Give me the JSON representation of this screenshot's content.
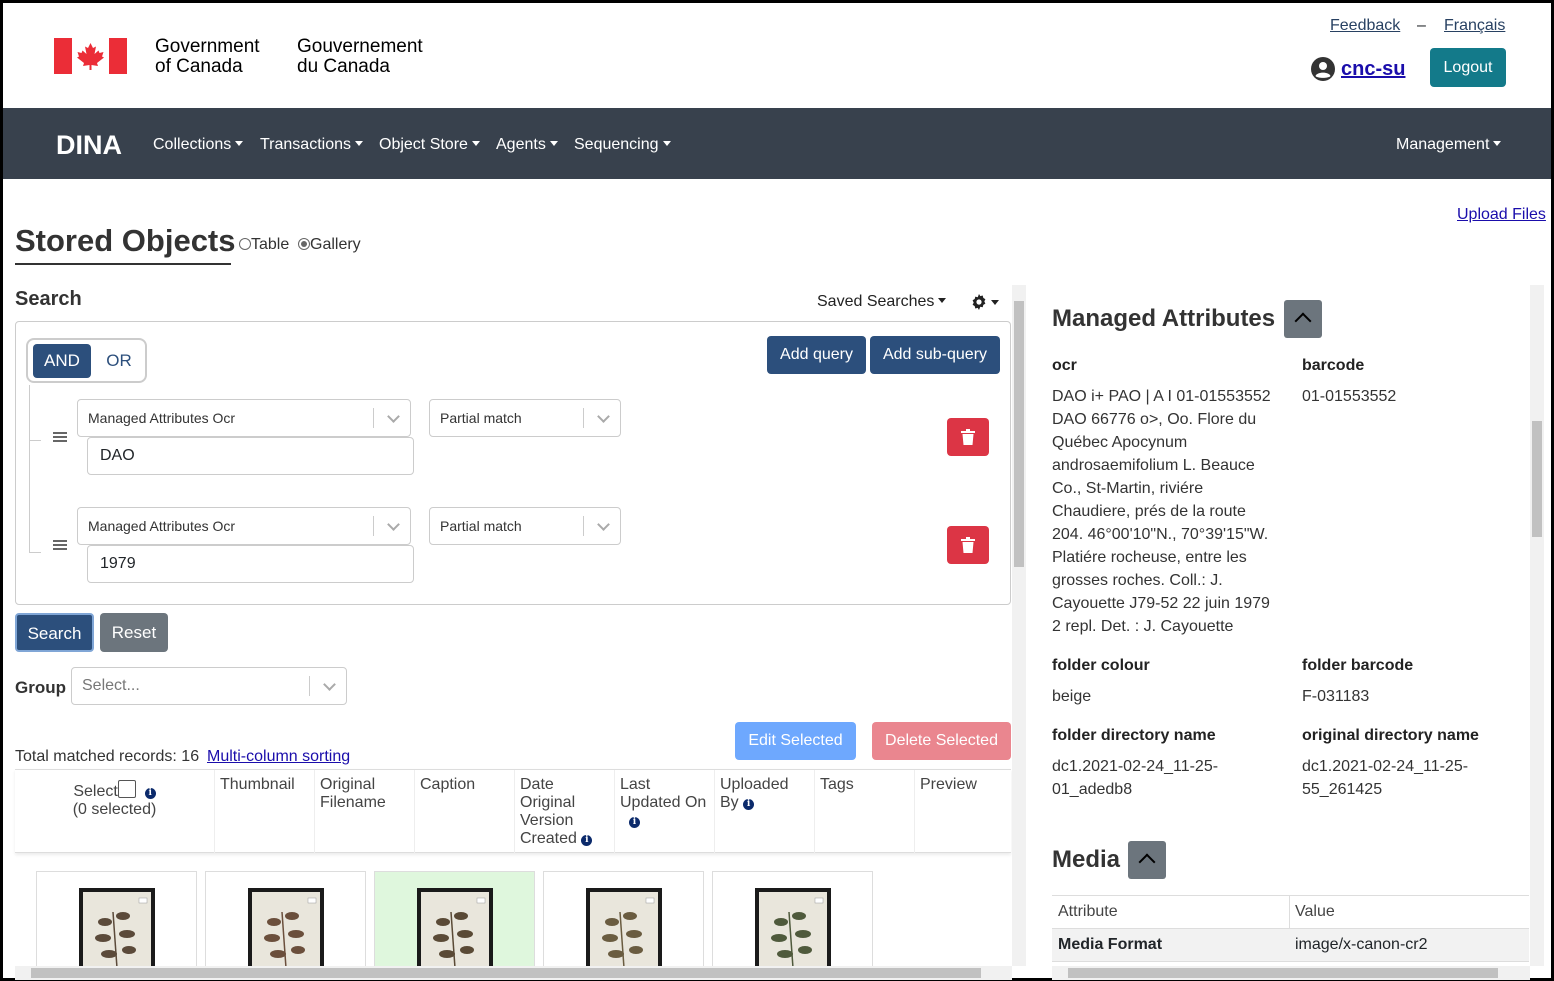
{
  "header": {
    "gov_en_line1": "Government",
    "gov_en_line2": "of Canada",
    "gov_fr_line1": "Gouvernement",
    "gov_fr_line2": "du Canada",
    "feedback": "Feedback",
    "separator": "–",
    "language": "Français",
    "username": "cnc-su",
    "logout": "Logout"
  },
  "nav": {
    "brand": "DINA",
    "items": [
      "Collections",
      "Transactions",
      "Object Store",
      "Agents",
      "Sequencing"
    ],
    "management": "Management"
  },
  "page": {
    "title": "Stored Objects",
    "view_table": "Table",
    "view_gallery": "Gallery",
    "view_selected": "Gallery",
    "upload_files": "Upload Files"
  },
  "search": {
    "heading": "Search",
    "saved_searches": "Saved Searches",
    "and": "AND",
    "or": "OR",
    "add_query": "Add query",
    "add_sub_query": "Add sub-query",
    "rows": [
      {
        "field": "Managed Attributes Ocr",
        "match": "Partial match",
        "value": "DAO"
      },
      {
        "field": "Managed Attributes Ocr",
        "match": "Partial match",
        "value": "1979"
      }
    ],
    "search_button": "Search",
    "reset_button": "Reset",
    "group_label": "Group",
    "group_placeholder": "Select..."
  },
  "results": {
    "edit_selected": "Edit Selected",
    "delete_selected": "Delete Selected",
    "total_label": "Total matched records: 16",
    "multi_sort": "Multi-column sorting",
    "columns": {
      "select": "Select",
      "selected_count": "(0 selected)",
      "thumbnail": "Thumbnail",
      "original_filename_1": "Original",
      "original_filename_2": "Filename",
      "caption": "Caption",
      "date_1": "Date",
      "date_2": "Original",
      "date_3": "Version",
      "date_4": "Created",
      "last_updated_1": "Last",
      "last_updated_2": "Updated On",
      "uploaded_by_1": "Uploaded",
      "uploaded_by_2": "By",
      "tags": "Tags",
      "preview": "Preview"
    },
    "cards_count": 5,
    "selected_card_index": 2
  },
  "managed_attributes": {
    "heading": "Managed Attributes",
    "items": [
      {
        "key": "ocr",
        "value": [
          "DAO i+ PAO | A I 01-01553552",
          "DAO 66776 o>, Oo. Flore du",
          "Québec Apocynum",
          "androsaemifolium L. Beauce",
          "Co., St-Martin, riviére",
          "Chaudiere, prés de la route",
          "204. 46°00'10\"N., 70°39'15\"W.",
          "Platiére rocheuse, entre les",
          "grosses roches. Coll.: J.",
          "Cayouette J79-52 22 juin 1979",
          "2 repl. Det. : J. Cayouette"
        ]
      },
      {
        "key": "barcode",
        "value": [
          "01-01553552"
        ]
      },
      {
        "key": "folder colour",
        "value": [
          "beige"
        ]
      },
      {
        "key": "folder barcode",
        "value": [
          "F-031183"
        ]
      },
      {
        "key": "folder directory name",
        "value": [
          "dc1.2021-02-24_11-25-",
          "01_adedb8"
        ]
      },
      {
        "key": "original directory name",
        "value": [
          "dc1.2021-02-24_11-25-",
          "55_261425"
        ]
      }
    ]
  },
  "media": {
    "heading": "Media",
    "col_attribute": "Attribute",
    "col_value": "Value",
    "rows": [
      {
        "attribute": "Media Format",
        "value": "image/x-canon-cr2"
      }
    ]
  },
  "colors": {
    "nav_bg": "#38414d",
    "primary": "#2c4f7c",
    "logout": "#137a8a",
    "danger": "#dc3545",
    "edit_selected": "#6ea8fe",
    "delete_selected": "#ea868f",
    "selected_card": "#dff7dd"
  }
}
